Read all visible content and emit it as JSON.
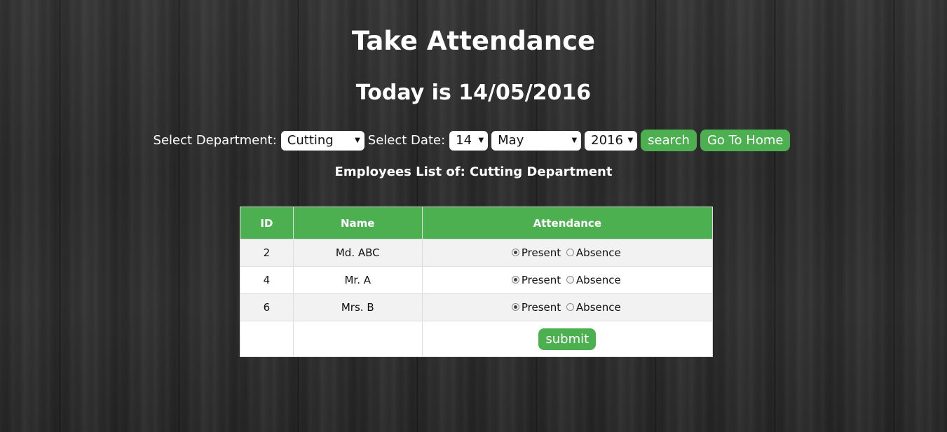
{
  "header": {
    "title": "Take Attendance",
    "today_prefix": "Today is 14/05/2016"
  },
  "filters": {
    "department_label": "Select Department:",
    "department_value": "Cutting",
    "date_label": "Select Date:",
    "day_value": "14",
    "month_value": "May",
    "year_value": "2016",
    "search_label": "search",
    "home_label": "Go To Home"
  },
  "list_title": "Employees List of: Cutting Department",
  "table": {
    "columns": [
      "ID",
      "Name",
      "Attendance"
    ],
    "rows": [
      {
        "id": "2",
        "name": "Md. ABC",
        "present": "Present",
        "absence": "Absence",
        "selected": "present"
      },
      {
        "id": "4",
        "name": "Mr. A",
        "present": "Present",
        "absence": "Absence",
        "selected": "present"
      },
      {
        "id": "6",
        "name": "Mrs. B",
        "present": "Present",
        "absence": "Absence",
        "selected": "present"
      }
    ],
    "submit_label": "submit"
  },
  "colors": {
    "accent": "#4caf50",
    "row_alt": "#f2f2f2"
  }
}
